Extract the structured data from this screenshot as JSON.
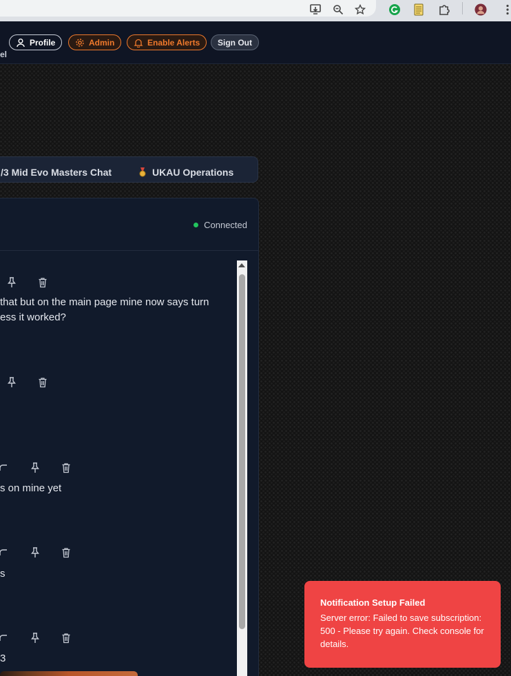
{
  "header": {
    "profile_label": "Profile",
    "admin_label": "Admin",
    "alerts_label": "Enable Alerts",
    "signout_label": "Sign Out",
    "title_fragment": "el"
  },
  "tabs": [
    {
      "label": "/3 Mid Evo Masters Chat"
    },
    {
      "label": "UKAU Operations",
      "icon": "medal-icon"
    }
  ],
  "chat": {
    "status": "Connected",
    "status_color": "#22c55e",
    "messages": [
      {
        "line1": "that but on the main page mine now says turn",
        "line2": "ess it worked?"
      },
      {
        "line1": ""
      },
      {
        "line1": "s on mine yet"
      },
      {
        "line1": "s"
      },
      {
        "line1": "3"
      }
    ]
  },
  "toast": {
    "title": "Notification Setup Failed",
    "body": "Server error: Failed to save subscription: 500 - Please try again. Check console for details.",
    "color": "#ef4444"
  },
  "colors": {
    "accent": "#f07a2c",
    "panel": "#111a2b"
  }
}
